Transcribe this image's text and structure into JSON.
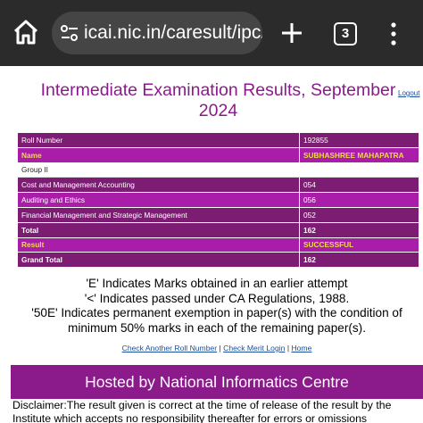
{
  "browser": {
    "url": "icai.nic.in/caresult/ipcA",
    "tab_count": "3"
  },
  "header": {
    "title": "Intermediate Examination Results, September 2024",
    "logout": "Logout"
  },
  "results": {
    "rows": [
      {
        "label": "Roll Number",
        "value": "192855"
      },
      {
        "label": "Name",
        "value": "SUBHASHREE MAHAPATRA"
      },
      {
        "label": "Group II",
        "value": ""
      },
      {
        "label": "Cost and Management Accounting",
        "value": "054"
      },
      {
        "label": "Auditing and Ethics",
        "value": "056"
      },
      {
        "label": "Financial Management and Strategic Management",
        "value": "052"
      },
      {
        "label": "Total",
        "value": "162"
      },
      {
        "label": "Result",
        "value": "SUCCESSFUL"
      },
      {
        "label": "Grand Total",
        "value": "162"
      }
    ]
  },
  "notes": [
    "'E' Indicates Marks obtained in an earlier attempt",
    "'<' Indicates passed under CA Regulations, 1988.",
    "'50E' Indicates permanent exemption in paper(s) with the condition of minimum 50% marks in each of the remaining paper(s)."
  ],
  "links": {
    "check_another": "Check Another Roll Number",
    "separator": "|",
    "check_merit": "Check Merit Login",
    "home": "Home"
  },
  "footer": {
    "hosted_by": "Hosted by National Informatics Centre",
    "disclaimer": "Disclaimer:The result given is correct at the time of release of the result by the Institute which accepts no responsibility thereafter for errors or omissions"
  },
  "colors": {
    "brand_purple": "#8b1a8b",
    "row_dark": "#7d1c73",
    "row_magenta": "#a81ea8",
    "highlight_gold": "#f2d94a"
  }
}
